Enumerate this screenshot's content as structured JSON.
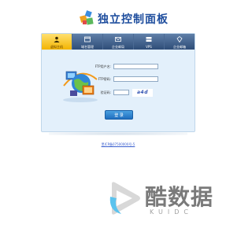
{
  "header": {
    "logo_text": "独立控制面板",
    "logo_icon": "colored-cubes-icon"
  },
  "tabs": [
    {
      "label": "虚拟主机",
      "icon": "user-icon",
      "active": true
    },
    {
      "label": "域名管理",
      "icon": "window-icon",
      "active": false
    },
    {
      "label": "企业邮局",
      "icon": "mail-icon",
      "active": false
    },
    {
      "label": "VPS",
      "icon": "server-icon",
      "active": false
    },
    {
      "label": "企业邮箱",
      "icon": "envelope-icon",
      "active": false
    }
  ],
  "form": {
    "username_label": "FTP用户名:",
    "username_value": "",
    "password_label": "FTP密码:",
    "password_value": "",
    "captcha_label": "验证码:",
    "captcha_value": "",
    "captcha_image_text": "a4d",
    "login_button": "登 录"
  },
  "footer": {
    "icp_link": "黑ICP备07500000号-5"
  },
  "watermark": {
    "brand": "酷数据",
    "sub": "KUIDC"
  },
  "colors": {
    "tab_bar": "#2e4d78",
    "tab_active": "#f3b400",
    "panel_bg": "#e3f0fb",
    "button": "#1f6fbf",
    "link": "#3a5fcf"
  }
}
